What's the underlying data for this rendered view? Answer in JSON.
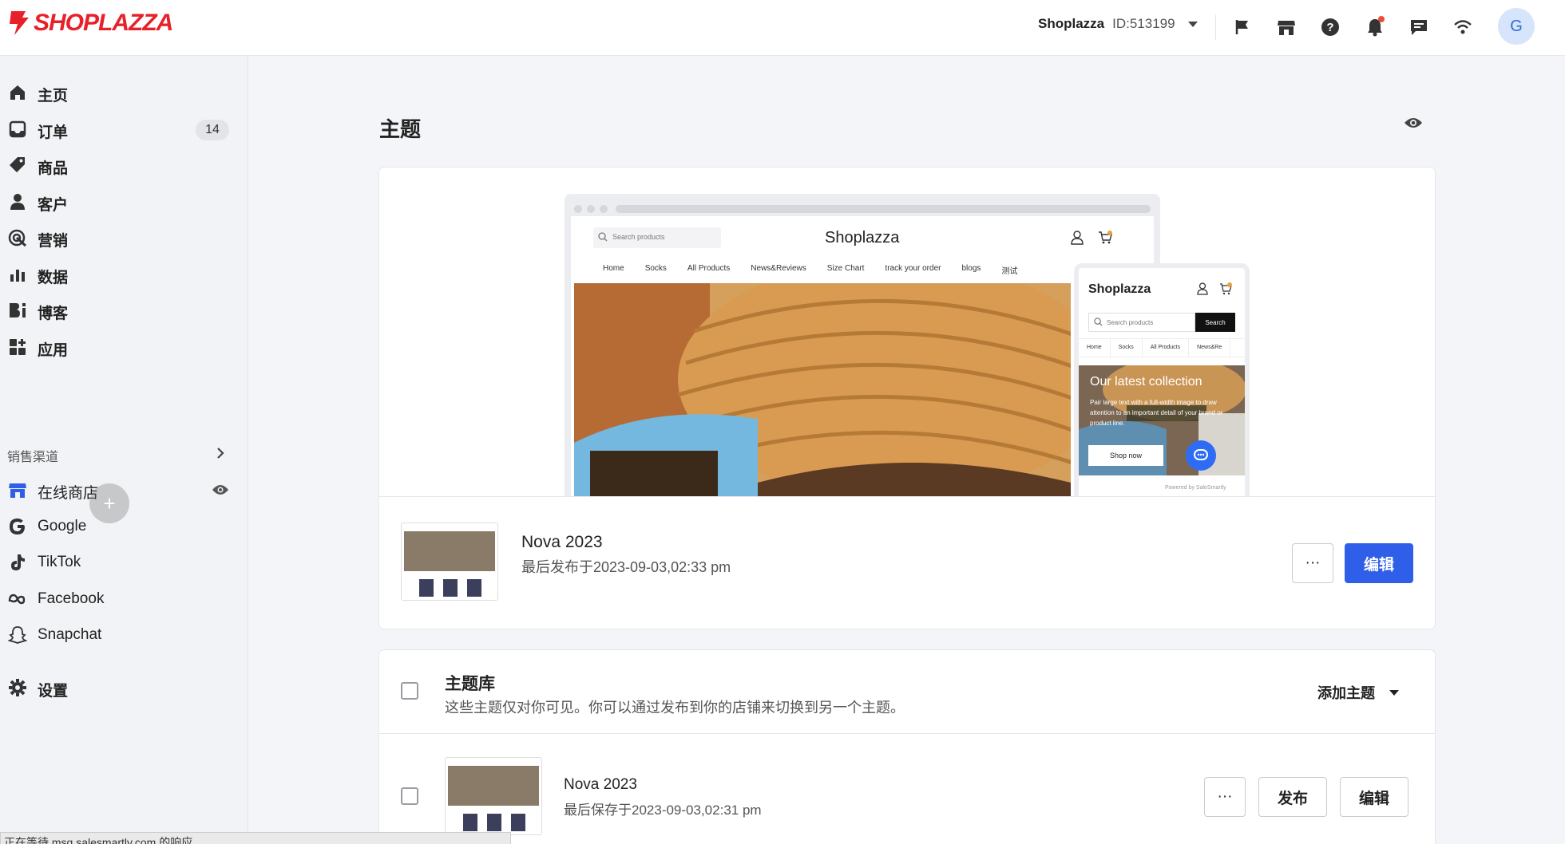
{
  "topbar": {
    "logo_text": "SHOPLAZZA",
    "shop_name": "Shoplazza",
    "shop_id": "ID:513199",
    "avatar_letter": "G",
    "icons": [
      "flag-icon",
      "store-icon",
      "help-icon",
      "bell-icon",
      "chat-icon",
      "wifi-icon"
    ]
  },
  "sidebar": {
    "items": [
      {
        "label": "主页",
        "icon": "home-icon"
      },
      {
        "label": "订单",
        "icon": "inbox-icon",
        "badge": "14"
      },
      {
        "label": "商品",
        "icon": "tag-icon"
      },
      {
        "label": "客户",
        "icon": "user-icon"
      },
      {
        "label": "营销",
        "icon": "target-icon"
      },
      {
        "label": "数据",
        "icon": "bar-chart-icon"
      },
      {
        "label": "博客",
        "icon": "blog-icon"
      },
      {
        "label": "应用",
        "icon": "apps-icon"
      }
    ],
    "channels_label": "销售渠道",
    "channels": [
      {
        "label": "在线商店",
        "icon": "store-icon"
      },
      {
        "label": "Google",
        "icon": "google-icon"
      },
      {
        "label": "TikTok",
        "icon": "tiktok-icon"
      },
      {
        "label": "Facebook",
        "icon": "meta-icon"
      },
      {
        "label": "Snapchat",
        "icon": "snapchat-icon"
      }
    ],
    "settings_label": "设置"
  },
  "main": {
    "title": "主题",
    "preview": {
      "desktop": {
        "search_placeholder": "Search products",
        "brand": "Shoplazza",
        "nav": [
          "Home",
          "Socks",
          "All Products",
          "News&Reviews",
          "Size Chart",
          "track your order",
          "blogs",
          "测试"
        ]
      },
      "mobile": {
        "brand": "Shoplazza",
        "search_placeholder": "Search products",
        "search_button": "Search",
        "nav": [
          "Home",
          "Socks",
          "All Products",
          "News&Re"
        ],
        "hero_title": "Our latest collection",
        "hero_desc": "Pair large text with a full-width image to draw attention to an important detail of your brand or product line.",
        "hero_button": "Shop now",
        "powered": "Powered by SaleSmartly"
      }
    },
    "current_theme": {
      "name": "Nova 2023",
      "meta": "最后发布于2023-09-03,02:33 pm",
      "more_label": "···",
      "edit_label": "编辑"
    },
    "library": {
      "title": "主题库",
      "desc": "这些主题仅对你可见。你可以通过发布到你的店铺来切换到另一个主题。",
      "add_label": "添加主题",
      "themes": [
        {
          "name": "Nova 2023",
          "meta": "最后保存于2023-09-03,02:31 pm",
          "more_label": "···",
          "publish_label": "发布",
          "edit_label": "编辑"
        }
      ]
    }
  },
  "statusbar": "正在等待 msg.salesmartly.com 的响应..."
}
